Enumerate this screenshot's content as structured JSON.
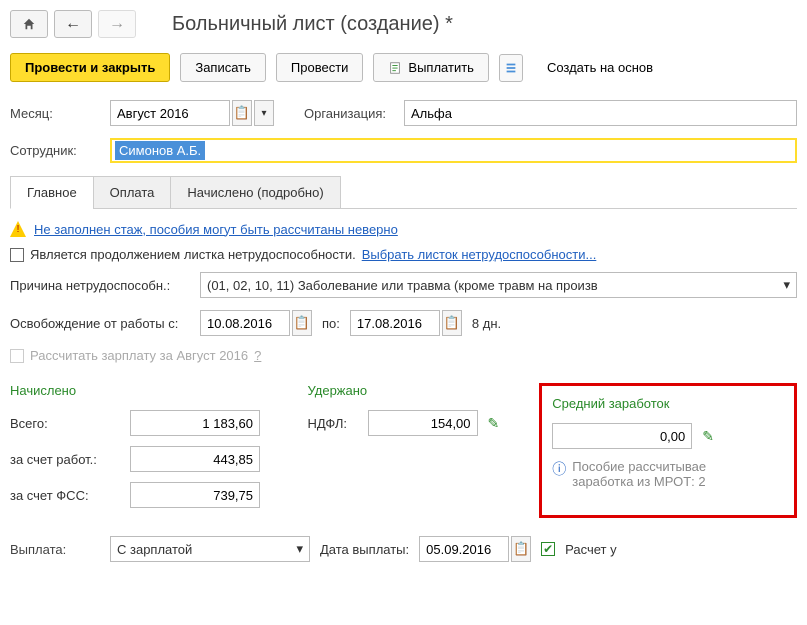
{
  "title": "Больничный лист (создание) *",
  "toolbar": {
    "post_close": "Провести и закрыть",
    "save": "Записать",
    "post": "Провести",
    "pay": "Выплатить",
    "create_based": "Создать на основ"
  },
  "form": {
    "month_lbl": "Месяц:",
    "month_val": "Август 2016",
    "org_lbl": "Организация:",
    "org_val": "Альфа",
    "emp_lbl": "Сотрудник:",
    "emp_val": "Симонов А.Б."
  },
  "tabs": {
    "main": "Главное",
    "pay": "Оплата",
    "accrued": "Начислено (подробно)"
  },
  "warnings": {
    "stage": "Не заполнен стаж, пособия могут быть рассчитаны неверно"
  },
  "fields": {
    "is_continuation": "Является продолжением листка нетрудоспособности.",
    "select_sheet": "Выбрать листок нетрудоспособности...",
    "reason_lbl": "Причина нетрудоспособн.:",
    "reason_val": "(01, 02, 10, 11) Заболевание или травма (кроме травм на произв",
    "release_lbl": "Освобождение от работы с:",
    "date_from": "10.08.2016",
    "to_lbl": "по:",
    "date_to": "17.08.2016",
    "days": "8 дн.",
    "recalc": "Рассчитать зарплату за Август 2016"
  },
  "totals": {
    "accrued_h": "Начислено",
    "withheld_h": "Удержано",
    "avg_h": "Средний заработок",
    "total_lbl": "Всего:",
    "total_val": "1 183,60",
    "employer_lbl": "за счет работ.:",
    "employer_val": "443,85",
    "fss_lbl": "за счет ФСС:",
    "fss_val": "739,75",
    "ndfl_lbl": "НДФЛ:",
    "ndfl_val": "154,00",
    "avg_val": "0,00",
    "info": "Пособие рассчитывае\nзаработка из МРОТ: 2"
  },
  "bottom": {
    "payment_lbl": "Выплата:",
    "payment_val": "С зарплатой",
    "pay_date_lbl": "Дата выплаты:",
    "pay_date_val": "05.09.2016",
    "calc_chk": "Расчет у"
  }
}
